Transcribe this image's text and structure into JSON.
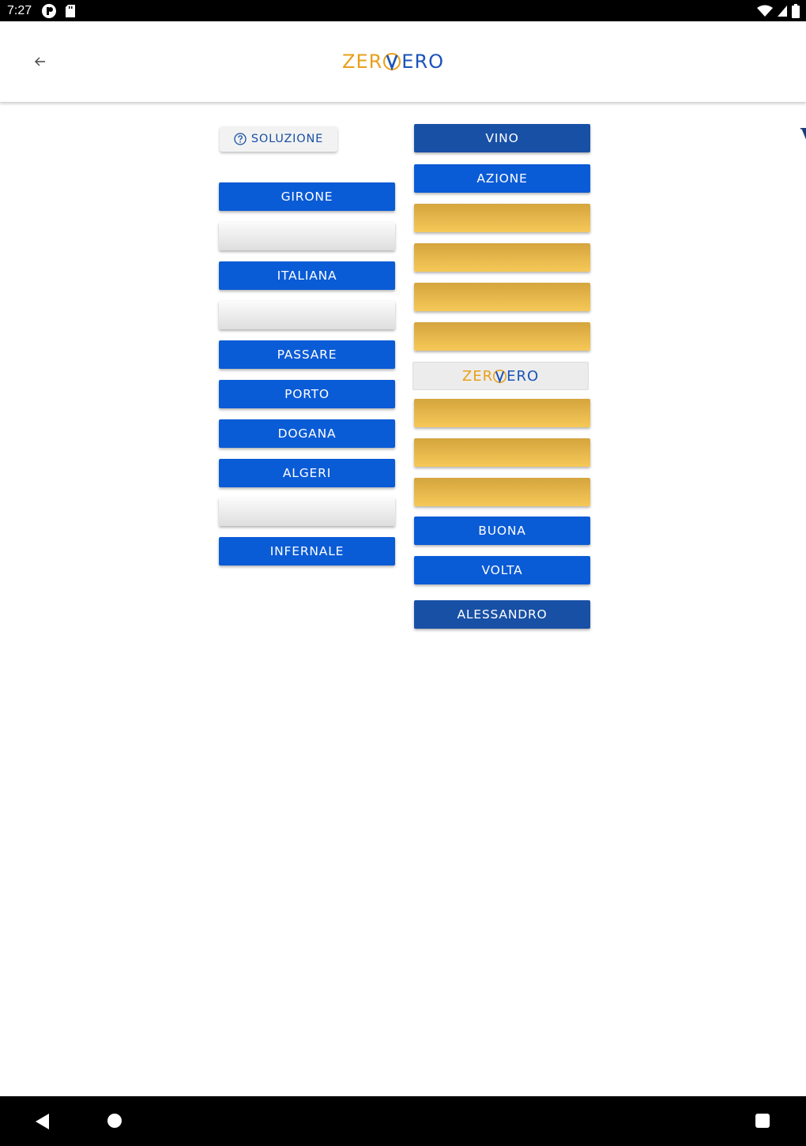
{
  "status_bar": {
    "time": "7:27",
    "icons": [
      "notification-app-icon",
      "sd-card-icon",
      "wifi-icon",
      "signal-icon",
      "battery-icon"
    ]
  },
  "app_bar": {
    "back_icon": "arrow-left-icon",
    "logo": {
      "left": "ZER",
      "mark": "V",
      "right": "ERO"
    }
  },
  "soluzione": {
    "icon": "help-circle-icon",
    "label": "SOLUZIONE"
  },
  "left_column": [
    {
      "label": "GIRONE",
      "state": "solved"
    },
    {
      "label": "",
      "state": "empty"
    },
    {
      "label": "ITALIANA",
      "state": "solved"
    },
    {
      "label": "",
      "state": "empty"
    },
    {
      "label": "PASSARE",
      "state": "solved"
    },
    {
      "label": "PORTO",
      "state": "solved"
    },
    {
      "label": "DOGANA",
      "state": "solved"
    },
    {
      "label": "ALGERI",
      "state": "solved"
    },
    {
      "label": "",
      "state": "empty"
    },
    {
      "label": "INFERNALE",
      "state": "solved"
    }
  ],
  "right_column": [
    {
      "label": "VINO",
      "state": "fixed"
    },
    {
      "label": "AZIONE",
      "state": "solved"
    },
    {
      "label": "",
      "state": "hidden"
    },
    {
      "label": "",
      "state": "hidden"
    },
    {
      "label": "",
      "state": "hidden"
    },
    {
      "label": "",
      "state": "hidden"
    },
    {
      "label": "",
      "state": "logo"
    },
    {
      "label": "",
      "state": "hidden"
    },
    {
      "label": "",
      "state": "hidden"
    },
    {
      "label": "",
      "state": "hidden"
    },
    {
      "label": "BUONA",
      "state": "solved"
    },
    {
      "label": "VOLTA",
      "state": "solved"
    },
    {
      "label": "ALESSANDRO",
      "state": "fixed"
    }
  ],
  "colors": {
    "solved_blue": "#0a5bd6",
    "fixed_navy": "#1850a6",
    "hidden_gold": "#f6c858",
    "logo_orange": "#e8a019",
    "logo_blue": "#1a53b8"
  },
  "nav_bar": {
    "icons": [
      "nav-back-icon",
      "nav-home-icon",
      "nav-recents-icon"
    ]
  }
}
